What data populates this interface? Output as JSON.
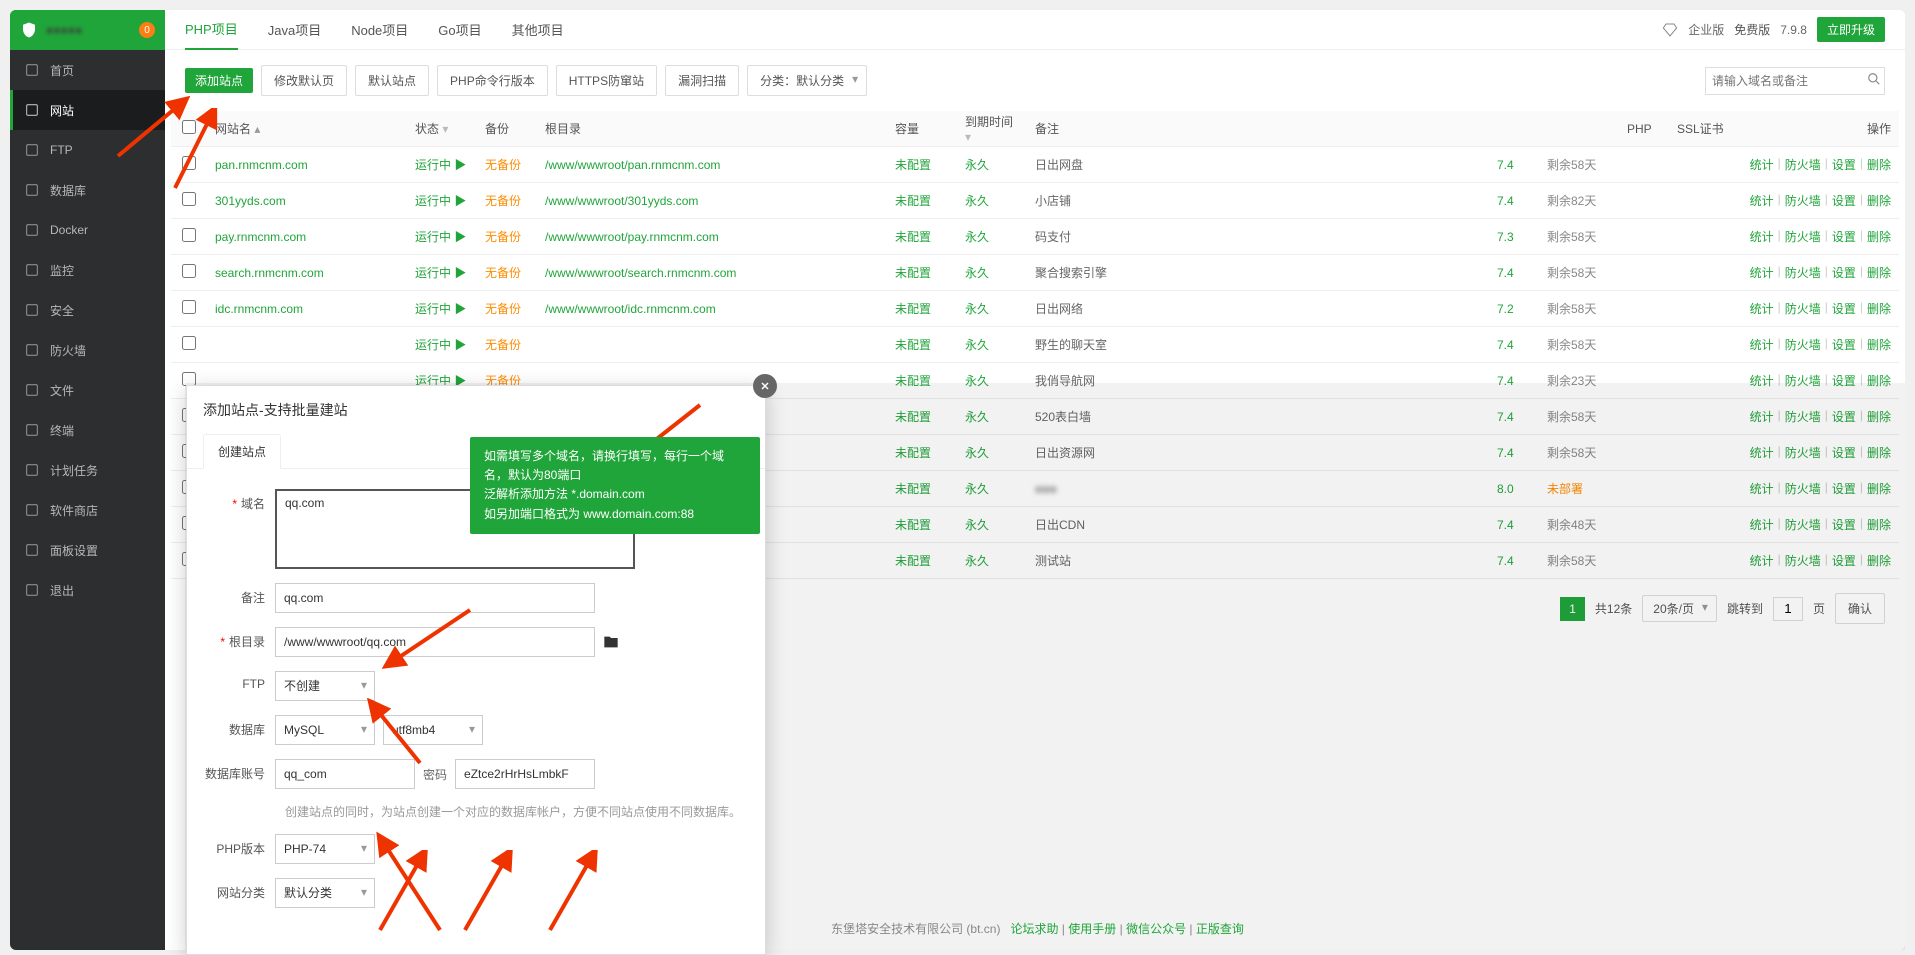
{
  "header": {
    "title": "●●●●●",
    "badge": "0"
  },
  "sidebar": [
    {
      "icon": "home-icon",
      "label": "首页"
    },
    {
      "icon": "globe-icon",
      "label": "网站",
      "active": true
    },
    {
      "icon": "ftp-icon",
      "label": "FTP"
    },
    {
      "icon": "database-icon",
      "label": "数据库"
    },
    {
      "icon": "docker-icon",
      "label": "Docker"
    },
    {
      "icon": "monitor-icon",
      "label": "监控"
    },
    {
      "icon": "security-icon",
      "label": "安全"
    },
    {
      "icon": "firewall-icon",
      "label": "防火墙"
    },
    {
      "icon": "files-icon",
      "label": "文件"
    },
    {
      "icon": "terminal-icon",
      "label": "终端"
    },
    {
      "icon": "cron-icon",
      "label": "计划任务"
    },
    {
      "icon": "store-icon",
      "label": "软件商店"
    },
    {
      "icon": "settings-icon",
      "label": "面板设置"
    },
    {
      "icon": "exit-icon",
      "label": "退出"
    }
  ],
  "tabs": {
    "items": [
      "PHP项目",
      "Java项目",
      "Node项目",
      "Go项目",
      "其他项目"
    ],
    "activeIndex": 0,
    "enterprise": "企业版",
    "versionLabel": "免费版",
    "version": "7.9.8",
    "upgrade": "立即升级"
  },
  "toolbar": {
    "addSite": "添加站点",
    "buttons": [
      "修改默认页",
      "默认站点",
      "PHP命令行版本",
      "HTTPS防窜站",
      "漏洞扫描"
    ],
    "categoryLabel": "分类：默认分类",
    "searchPlaceholder": "请输入域名或备注"
  },
  "columns": {
    "site": "网站名",
    "status": "状态",
    "backup": "备份",
    "root": "根目录",
    "capacity": "容量",
    "expire": "到期时间",
    "note": "备注",
    "php": "PHP",
    "ssl": "SSL证书",
    "ops": "操作"
  },
  "statusRunning": "运行中",
  "backupNone": "无备份",
  "capNone": "未配置",
  "expForever": "永久",
  "ops": {
    "stats": "统计",
    "firewall": "防火墙",
    "settings": "设置",
    "delete": "删除"
  },
  "rows": [
    {
      "site": "pan.rnmcnm.com",
      "root": "/www/wwwroot/pan.rnmcnm.com",
      "note": "日出网盘",
      "php": "7.4",
      "ssl": "剩余58天"
    },
    {
      "site": "301yyds.com",
      "root": "/www/wwwroot/301yyds.com",
      "note": "小店铺",
      "php": "7.4",
      "ssl": "剩余82天"
    },
    {
      "site": "pay.rnmcnm.com",
      "root": "/www/wwwroot/pay.rnmcnm.com",
      "note": "码支付",
      "php": "7.3",
      "ssl": "剩余58天"
    },
    {
      "site": "search.rnmcnm.com",
      "root": "/www/wwwroot/search.rnmcnm.com",
      "note": "聚合搜索引擎",
      "php": "7.4",
      "ssl": "剩余58天"
    },
    {
      "site": "idc.rnmcnm.com",
      "root": "/www/wwwroot/idc.rnmcnm.com",
      "note": "日出网络",
      "php": "7.2",
      "ssl": "剩余58天"
    },
    {
      "site": "",
      "root": "",
      "note": "野生的聊天室",
      "php": "7.4",
      "ssl": "剩余58天"
    },
    {
      "site": "",
      "root": "",
      "note": "我俏导航网",
      "php": "7.4",
      "ssl": "剩余23天"
    },
    {
      "site": "",
      "root": "",
      "note": "520表白墙",
      "php": "7.4",
      "ssl": "剩余58天"
    },
    {
      "site": "",
      "root": "",
      "note": "日出资源网",
      "php": "7.4",
      "ssl": "剩余58天"
    },
    {
      "site": "",
      "root": "",
      "note": "●●●",
      "php": "8.0",
      "ssl": "未部署",
      "sslOrange": true
    },
    {
      "site": "",
      "root": "",
      "note": "日出CDN",
      "php": "7.4",
      "ssl": "剩余48天"
    },
    {
      "site": "",
      "root": "",
      "note": "测试站",
      "php": "7.4",
      "ssl": "剩余58天"
    }
  ],
  "pagination": {
    "page": "1",
    "total": "共12条",
    "perPage": "20条/页",
    "jumpLabel": "跳转到",
    "pageWord": "页",
    "confirm": "确认"
  },
  "modal": {
    "title": "添加站点-支持批量建站",
    "tab": "创建站点",
    "tooltip": {
      "l1": "如需填写多个域名，请换行填写，每行一个域名，默认为80端口",
      "l2": "泛解析添加方法 *.domain.com",
      "l3": "如另加端口格式为 www.domain.com:88"
    },
    "labels": {
      "domain": "域名",
      "note": "备注",
      "root": "根目录",
      "ftp": "FTP",
      "database": "数据库",
      "dbAccount": "数据库账号",
      "password": "密码",
      "phpVersion": "PHP版本",
      "category": "网站分类"
    },
    "values": {
      "domain": "qq.com",
      "note": "qq.com",
      "root": "/www/wwwroot/qq.com",
      "ftp": "不创建",
      "database": "MySQL",
      "charset": "utf8mb4",
      "dbAccount": "qq_com",
      "password": "eZtce2rHrHsLmbkF",
      "phpVersion": "PHP-74",
      "category": "默认分类"
    },
    "hint": "创建站点的同时，为站点创建一个对应的数据库帐户，方便不同站点使用不同数据库。"
  },
  "footer": {
    "company": "东堡塔安全技术有限公司 (bt.cn)",
    "links": [
      "论坛求助",
      "使用手册",
      "微信公众号",
      "正版查询"
    ]
  }
}
